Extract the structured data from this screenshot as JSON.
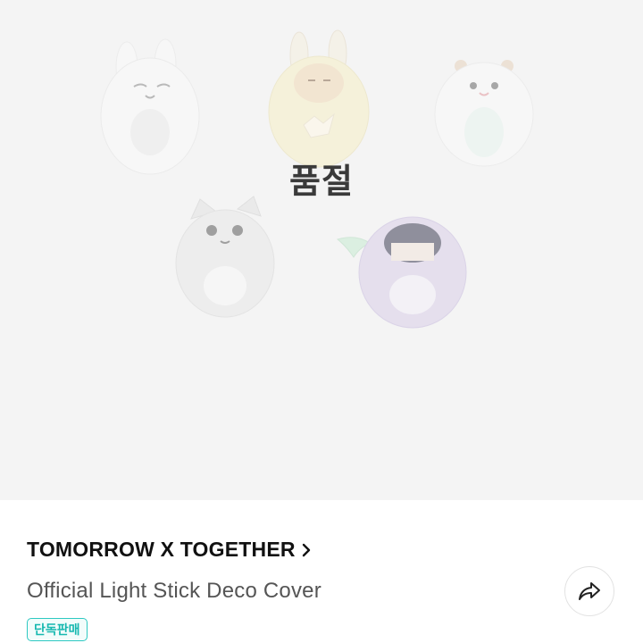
{
  "product": {
    "status_overlay": "품절",
    "artist": "TOMORROW X TOGETHER",
    "name": "Official Light Stick Deco Cover",
    "badge": "단독판매"
  },
  "icons": {
    "artist_link": "chevron-right-icon",
    "share": "share-arrow-icon"
  },
  "colors": {
    "hero_background": "#f4f4f4",
    "badge_accent": "#2ec9c2"
  }
}
